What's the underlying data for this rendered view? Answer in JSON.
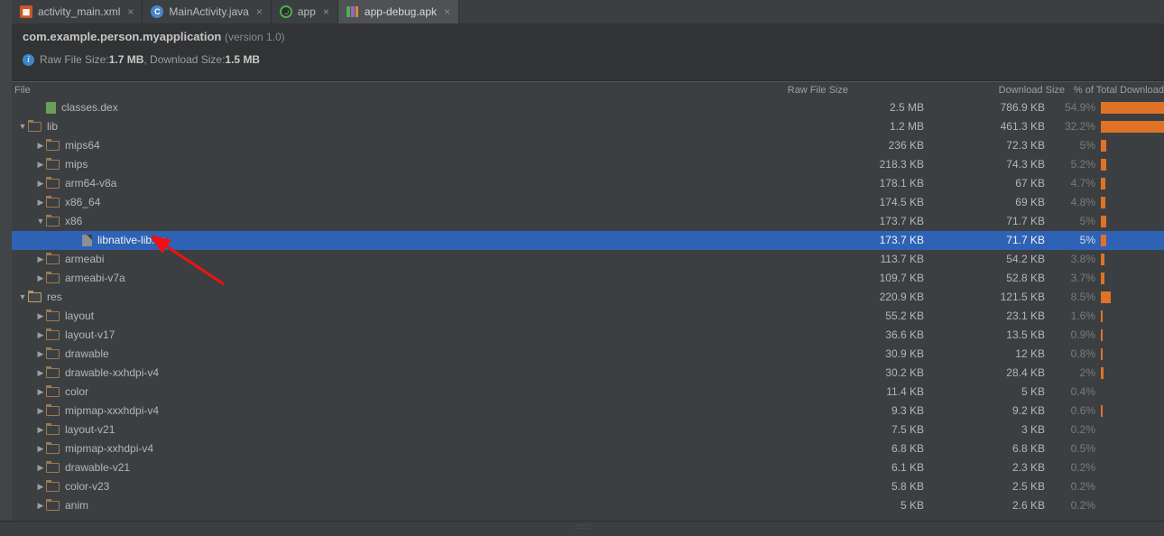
{
  "tabs": [
    {
      "label": "activity_main.xml",
      "icon": "xml",
      "closable": true,
      "active": false
    },
    {
      "label": "MainActivity.java",
      "icon": "java",
      "closable": true,
      "active": false
    },
    {
      "label": "app",
      "icon": "app",
      "closable": true,
      "active": false
    },
    {
      "label": "app-debug.apk",
      "icon": "apk",
      "closable": true,
      "active": true
    }
  ],
  "header": {
    "package": "com.example.person.myapplication",
    "version": "(version 1.0)",
    "raw_label": "Raw File Size: ",
    "raw_value": "1.7 MB",
    "sep": ", Download Size: ",
    "dl_value": "1.5 MB"
  },
  "columns": {
    "file": "File",
    "raw": "Raw File Size",
    "dl": "Download Size",
    "pct": "% of Total Download"
  },
  "rows": [
    {
      "indent": 1,
      "arrow": "",
      "icon": "dex",
      "name": "classes.dex",
      "raw": "2.5 MB",
      "dl": "786.9 KB",
      "pct": "54.9%",
      "bar": 70,
      "sel": false
    },
    {
      "indent": 0,
      "arrow": "▼",
      "icon": "folder",
      "name": "lib",
      "raw": "1.2 MB",
      "dl": "461.3 KB",
      "pct": "32.2%",
      "bar": 70,
      "sel": false
    },
    {
      "indent": 1,
      "arrow": "▶",
      "icon": "folder",
      "name": "mips64",
      "raw": "236 KB",
      "dl": "72.3 KB",
      "pct": "5%",
      "bar": 6,
      "sel": false
    },
    {
      "indent": 1,
      "arrow": "▶",
      "icon": "folder",
      "name": "mips",
      "raw": "218.3 KB",
      "dl": "74.3 KB",
      "pct": "5.2%",
      "bar": 6,
      "sel": false
    },
    {
      "indent": 1,
      "arrow": "▶",
      "icon": "folder",
      "name": "arm64-v8a",
      "raw": "178.1 KB",
      "dl": "67 KB",
      "pct": "4.7%",
      "bar": 5,
      "sel": false
    },
    {
      "indent": 1,
      "arrow": "▶",
      "icon": "folder",
      "name": "x86_64",
      "raw": "174.5 KB",
      "dl": "69 KB",
      "pct": "4.8%",
      "bar": 5,
      "sel": false
    },
    {
      "indent": 1,
      "arrow": "▼",
      "icon": "folder",
      "name": "x86",
      "raw": "173.7 KB",
      "dl": "71.7 KB",
      "pct": "5%",
      "bar": 6,
      "sel": false
    },
    {
      "indent": 3,
      "arrow": "",
      "icon": "file",
      "name": "libnative-lib.so",
      "raw": "173.7 KB",
      "dl": "71.7 KB",
      "pct": "5%",
      "bar": 6,
      "sel": true
    },
    {
      "indent": 1,
      "arrow": "▶",
      "icon": "folder",
      "name": "armeabi",
      "raw": "113.7 KB",
      "dl": "54.2 KB",
      "pct": "3.8%",
      "bar": 4,
      "sel": false
    },
    {
      "indent": 1,
      "arrow": "▶",
      "icon": "folder",
      "name": "armeabi-v7a",
      "raw": "109.7 KB",
      "dl": "52.8 KB",
      "pct": "3.7%",
      "bar": 4,
      "sel": false
    },
    {
      "indent": 0,
      "arrow": "▼",
      "icon": "res",
      "name": "res",
      "raw": "220.9 KB",
      "dl": "121.5 KB",
      "pct": "8.5%",
      "bar": 11,
      "sel": false
    },
    {
      "indent": 1,
      "arrow": "▶",
      "icon": "folder",
      "name": "layout",
      "raw": "55.2 KB",
      "dl": "23.1 KB",
      "pct": "1.6%",
      "bar": 2,
      "sel": false
    },
    {
      "indent": 1,
      "arrow": "▶",
      "icon": "folder",
      "name": "layout-v17",
      "raw": "36.6 KB",
      "dl": "13.5 KB",
      "pct": "0.9%",
      "bar": 2,
      "sel": false
    },
    {
      "indent": 1,
      "arrow": "▶",
      "icon": "folder",
      "name": "drawable",
      "raw": "30.9 KB",
      "dl": "12 KB",
      "pct": "0.8%",
      "bar": 2,
      "sel": false
    },
    {
      "indent": 1,
      "arrow": "▶",
      "icon": "folder",
      "name": "drawable-xxhdpi-v4",
      "raw": "30.2 KB",
      "dl": "28.4 KB",
      "pct": "2%",
      "bar": 3,
      "sel": false
    },
    {
      "indent": 1,
      "arrow": "▶",
      "icon": "folder",
      "name": "color",
      "raw": "11.4 KB",
      "dl": "5 KB",
      "pct": "0.4%",
      "bar": 0,
      "sel": false
    },
    {
      "indent": 1,
      "arrow": "▶",
      "icon": "folder",
      "name": "mipmap-xxxhdpi-v4",
      "raw": "9.3 KB",
      "dl": "9.2 KB",
      "pct": "0.6%",
      "bar": 2,
      "sel": false
    },
    {
      "indent": 1,
      "arrow": "▶",
      "icon": "folder",
      "name": "layout-v21",
      "raw": "7.5 KB",
      "dl": "3 KB",
      "pct": "0.2%",
      "bar": 0,
      "sel": false
    },
    {
      "indent": 1,
      "arrow": "▶",
      "icon": "folder",
      "name": "mipmap-xxhdpi-v4",
      "raw": "6.8 KB",
      "dl": "6.8 KB",
      "pct": "0.5%",
      "bar": 0,
      "sel": false
    },
    {
      "indent": 1,
      "arrow": "▶",
      "icon": "folder",
      "name": "drawable-v21",
      "raw": "6.1 KB",
      "dl": "2.3 KB",
      "pct": "0.2%",
      "bar": 0,
      "sel": false
    },
    {
      "indent": 1,
      "arrow": "▶",
      "icon": "folder",
      "name": "color-v23",
      "raw": "5.8 KB",
      "dl": "2.5 KB",
      "pct": "0.2%",
      "bar": 0,
      "sel": false
    },
    {
      "indent": 1,
      "arrow": "▶",
      "icon": "folder",
      "name": "anim",
      "raw": "5 KB",
      "dl": "2.6 KB",
      "pct": "0.2%",
      "bar": 0,
      "sel": false
    }
  ],
  "colors": {
    "accent": "#e07227",
    "select": "#2e62b5"
  }
}
